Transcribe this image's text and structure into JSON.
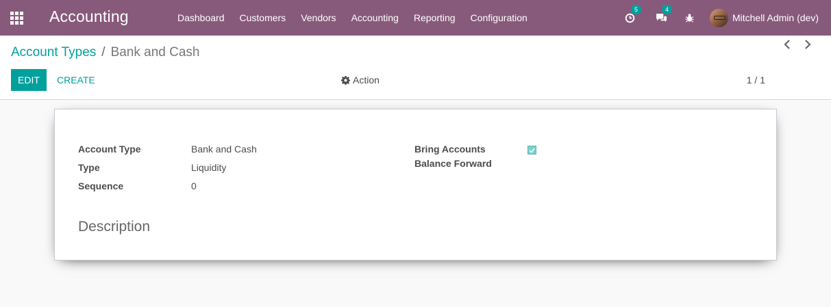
{
  "navbar": {
    "brand": "Accounting",
    "menu": [
      "Dashboard",
      "Customers",
      "Vendors",
      "Accounting",
      "Reporting",
      "Configuration"
    ],
    "activity_count": "5",
    "message_count": "4",
    "user_name": "Mitchell Admin (dev)",
    "bg_color": "#875a7b"
  },
  "breadcrumb": {
    "parent": "Account Types",
    "separator": "/",
    "current": "Bank and Cash"
  },
  "toolbar": {
    "edit_label": "EDIT",
    "create_label": "CREATE",
    "action_label": "Action",
    "pager_value": "1 / 1"
  },
  "form": {
    "fields": [
      {
        "label": "Account Type",
        "value": "Bank and Cash"
      },
      {
        "label": "Type",
        "value": "Liquidity"
      },
      {
        "label": "Sequence",
        "value": "0"
      }
    ],
    "bring_forward_label_1": "Bring Accounts",
    "bring_forward_label_2": "Balance Forward",
    "bring_forward_checked": true,
    "description_title": "Description"
  },
  "colors": {
    "primary": "#00a09d",
    "brand": "#875a7b"
  }
}
